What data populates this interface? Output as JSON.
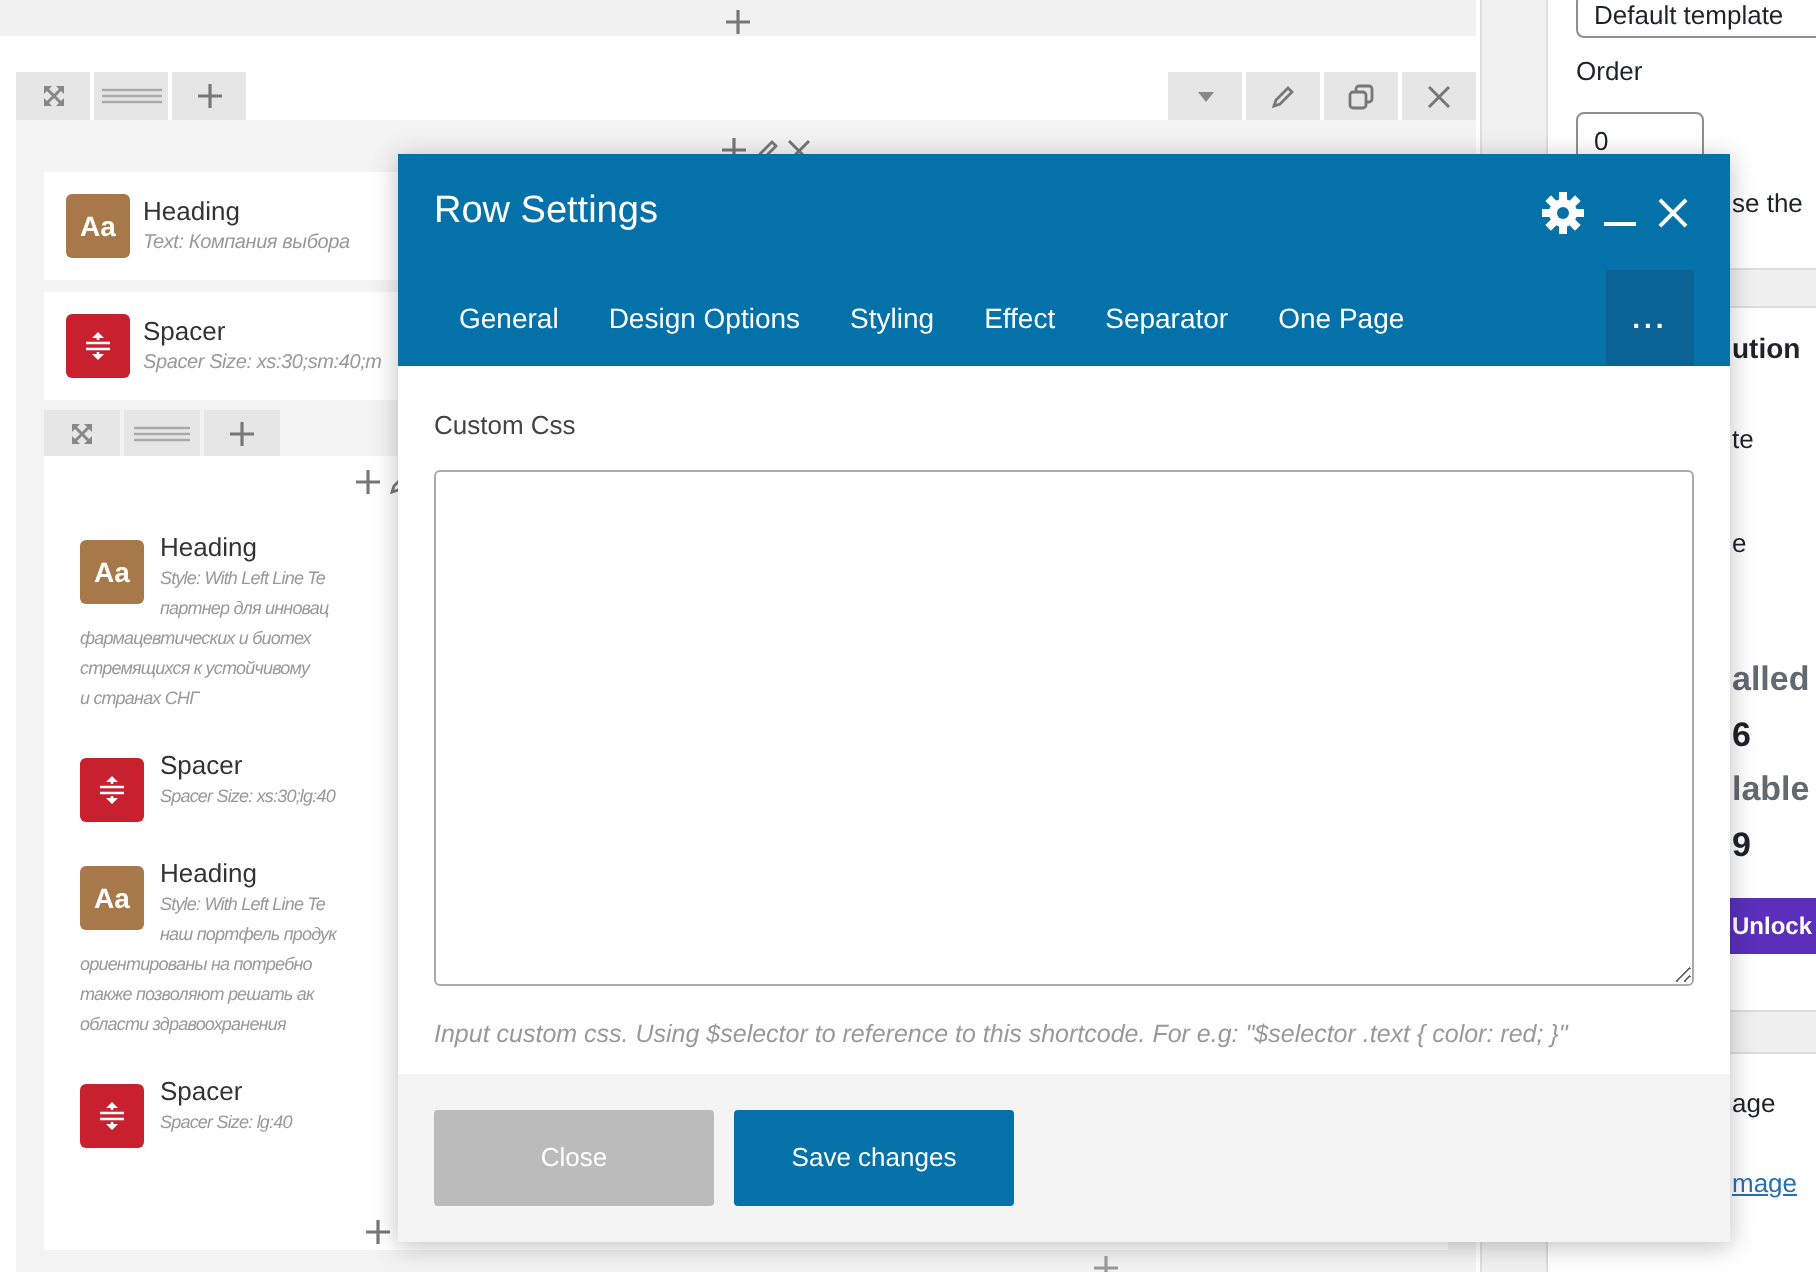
{
  "builder": {
    "row": {
      "elements": [
        {
          "kind": "heading",
          "badge": "Aa",
          "title": "Heading",
          "lines": [
            "Text: Компания выбора"
          ]
        },
        {
          "kind": "spacer",
          "title": "Spacer",
          "lines": [
            "Spacer Size: xs:30;sm:40;m"
          ]
        }
      ],
      "inner_row": {
        "elements": [
          {
            "kind": "heading",
            "badge": "Aa",
            "title": "Heading",
            "lines": [
              "Style: With Left Line  Te",
              "партнер для инновац",
              "фармацевтических и биотех",
              "стремящихся к устойчивому",
              "и странах СНГ"
            ]
          },
          {
            "kind": "spacer",
            "title": "Spacer",
            "lines": [
              "Spacer Size: xs:30;lg:40"
            ]
          },
          {
            "kind": "heading",
            "badge": "Aa",
            "title": "Heading",
            "lines": [
              "Style: With Left Line  Te",
              "наш портфель продук",
              "ориентированы на потребно",
              "также позволяют решать ак",
              "области здравоохранения"
            ]
          },
          {
            "kind": "spacer",
            "title": "Spacer",
            "lines": [
              "Spacer Size: lg:40"
            ]
          }
        ]
      }
    }
  },
  "sidebar": {
    "template": "Default template",
    "order_label": "Order",
    "order_value": "0",
    "note": "se the",
    "panels": [
      {
        "title": "ution",
        "items": [
          {
            "kind": "text",
            "text": "te"
          },
          {
            "kind": "text",
            "text": "e"
          },
          {
            "kind": "stat-label",
            "text": "alled"
          },
          {
            "kind": "stat-value",
            "text": "6"
          },
          {
            "kind": "stat-label",
            "text": "lable"
          },
          {
            "kind": "stat-value",
            "text": "9"
          },
          {
            "kind": "button",
            "text": "Unlock"
          }
        ]
      },
      {
        "title": "age",
        "items": [
          {
            "kind": "link",
            "text": "mage"
          }
        ]
      }
    ]
  },
  "modal": {
    "title": "Row Settings",
    "tabs": [
      {
        "kind": "tab",
        "label": "General",
        "selected": false
      },
      {
        "kind": "tab",
        "label": "Design Options",
        "selected": false
      },
      {
        "kind": "tab",
        "label": "Styling",
        "selected": false
      },
      {
        "kind": "tab",
        "label": "Effect",
        "selected": false
      },
      {
        "kind": "tab",
        "label": "Separator",
        "selected": false
      },
      {
        "kind": "tab",
        "label": "One Page",
        "selected": false
      },
      {
        "kind": "more",
        "label": "...",
        "selected": true
      }
    ],
    "field": {
      "label": "Custom Css"
    },
    "help": "Input custom css. Using $selector to reference to this shortcode. For e.g: \"$selector .text { color: red; }\"",
    "buttons": [
      {
        "kind": "secondary",
        "label": "Close"
      },
      {
        "kind": "primary",
        "label": "Save changes"
      }
    ]
  }
}
